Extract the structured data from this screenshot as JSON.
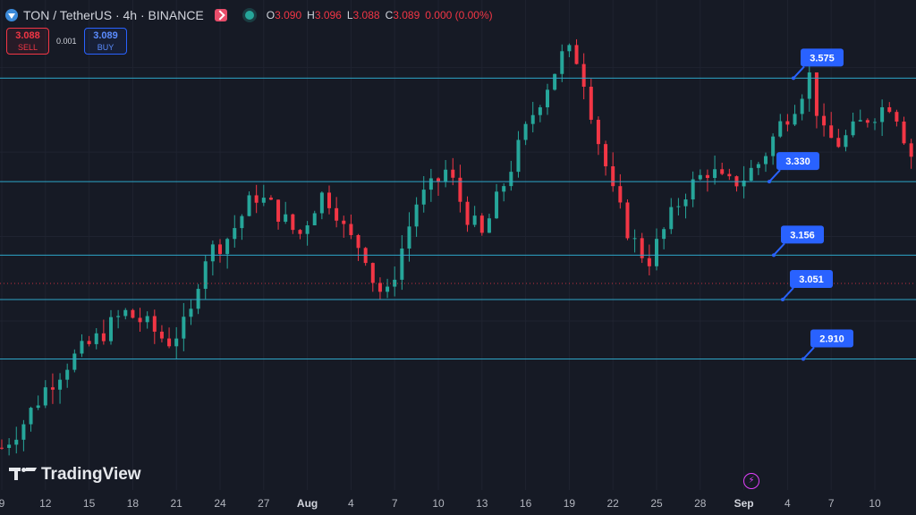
{
  "header": {
    "symbol_title": "TON / TetherUS · 4h · BINANCE",
    "ohlc": [
      {
        "k": "O",
        "v": "3.090"
      },
      {
        "k": "H",
        "v": "3.096"
      },
      {
        "k": "L",
        "v": "3.088"
      },
      {
        "k": "C",
        "v": "3.089"
      },
      {
        "k": "",
        "v": "0.000 (0.00%)"
      }
    ]
  },
  "trade": {
    "sell_price": "3.088",
    "sell_label": "SELL",
    "spread": "0.001",
    "buy_price": "3.089",
    "buy_label": "BUY"
  },
  "brand": {
    "logo_text": "TradingView"
  },
  "colors": {
    "background": "#161a25",
    "up": "#26a69a",
    "down": "#f23645",
    "level_line": "#2ea6c8",
    "label_bg": "#2962ff",
    "last_price_line": "#f23645"
  },
  "chart_data": {
    "type": "candlestick",
    "title": "",
    "xlabel": "",
    "ylabel": "",
    "x_ticks": [
      "9",
      "12",
      "15",
      "18",
      "21",
      "24",
      "27",
      "Aug",
      "4",
      "7",
      "10",
      "13",
      "16",
      "19",
      "22",
      "25",
      "28",
      "Sep",
      "4",
      "7",
      "10"
    ],
    "month_ticks": [
      "Aug",
      "Sep"
    ],
    "ylim": [
      2.6,
      3.76
    ],
    "last_price": 3.089,
    "horizontal_levels": [
      {
        "label": "3.575",
        "value": 3.575
      },
      {
        "label": "3.330",
        "value": 3.33
      },
      {
        "label": "3.156",
        "value": 3.156
      },
      {
        "label": "3.051",
        "value": 3.051
      },
      {
        "label": "2.910",
        "value": 2.91
      }
    ],
    "price_path": [
      [
        0,
        2.7
      ],
      [
        0.5,
        2.76
      ],
      [
        1.0,
        2.84
      ],
      [
        1.5,
        2.9
      ],
      [
        2.2,
        2.96
      ],
      [
        2.8,
        3.02
      ],
      [
        3.2,
        3.0
      ],
      [
        3.8,
        2.95
      ],
      [
        4.3,
        3.0
      ],
      [
        4.6,
        3.15
      ],
      [
        5.2,
        3.2
      ],
      [
        5.8,
        3.3
      ],
      [
        6.3,
        3.26
      ],
      [
        6.8,
        3.2
      ],
      [
        7.3,
        3.3
      ],
      [
        7.6,
        3.28
      ],
      [
        7.9,
        3.2
      ],
      [
        8.3,
        3.17
      ],
      [
        8.5,
        3.1
      ],
      [
        8.8,
        3.05
      ],
      [
        9.1,
        3.15
      ],
      [
        9.5,
        3.28
      ],
      [
        9.9,
        3.32
      ],
      [
        10.2,
        3.36
      ],
      [
        10.6,
        3.26
      ],
      [
        11.0,
        3.2
      ],
      [
        11.4,
        3.3
      ],
      [
        11.8,
        3.4
      ],
      [
        12.2,
        3.5
      ],
      [
        12.6,
        3.58
      ],
      [
        12.9,
        3.64
      ],
      [
        13.2,
        3.62
      ],
      [
        13.4,
        3.55
      ],
      [
        13.6,
        3.45
      ],
      [
        13.8,
        3.38
      ],
      [
        14.0,
        3.3
      ],
      [
        14.4,
        3.2
      ],
      [
        14.8,
        3.14
      ],
      [
        15.2,
        3.22
      ],
      [
        15.6,
        3.3
      ],
      [
        16.2,
        3.36
      ],
      [
        16.6,
        3.32
      ],
      [
        17.0,
        3.34
      ],
      [
        17.4,
        3.38
      ],
      [
        17.8,
        3.46
      ],
      [
        18.2,
        3.52
      ],
      [
        18.5,
        3.58
      ],
      [
        18.8,
        3.44
      ],
      [
        19.2,
        3.42
      ],
      [
        19.8,
        3.48
      ],
      [
        20.4,
        3.52
      ],
      [
        20.8,
        3.4
      ],
      [
        21.2,
        3.32
      ],
      [
        21.6,
        3.22
      ],
      [
        22.0,
        3.24
      ],
      [
        22.5,
        3.26
      ],
      [
        23.0,
        3.28
      ],
      [
        23.4,
        3.38
      ],
      [
        23.8,
        3.36
      ],
      [
        24.2,
        3.3
      ],
      [
        24.5,
        3.2
      ],
      [
        24.8,
        3.14
      ],
      [
        25.2,
        3.12
      ],
      [
        25.6,
        3.16
      ],
      [
        26.0,
        3.13
      ],
      [
        26.4,
        3.16
      ],
      [
        26.8,
        3.06
      ],
      [
        27.0,
        3.03
      ],
      [
        27.2,
        3.09
      ]
    ]
  }
}
